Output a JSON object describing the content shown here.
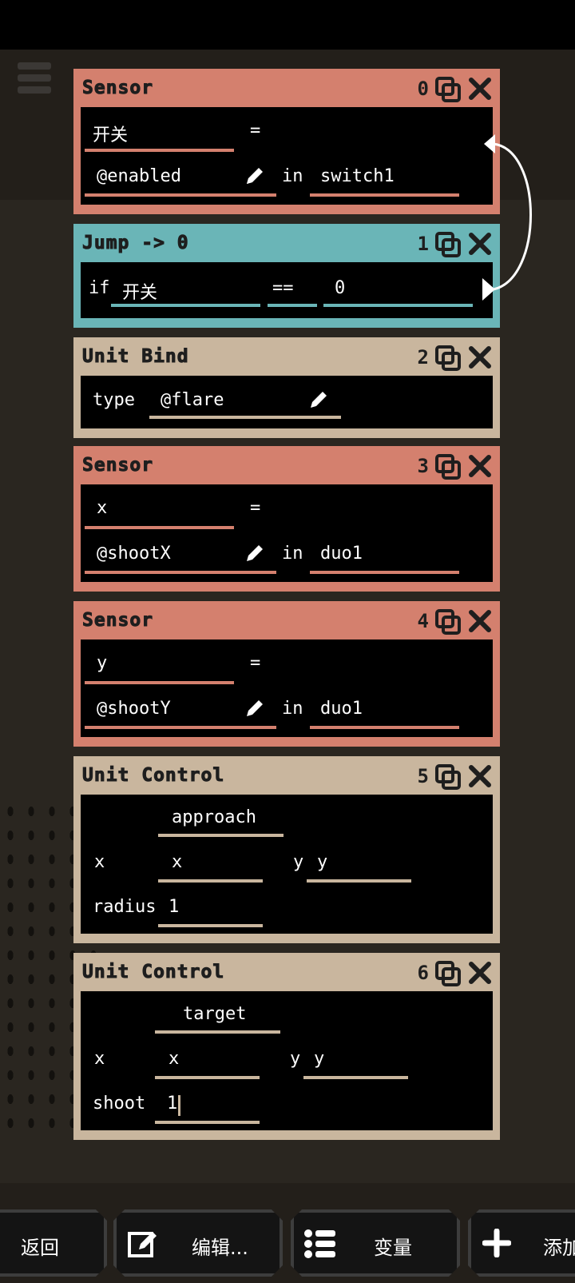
{
  "blocks": [
    {
      "title": "Sensor",
      "index": "0",
      "var": "开关",
      "eq": "=",
      "sensor": "@enabled",
      "in": "in",
      "target": "switch1"
    },
    {
      "title": "Jump -> 0",
      "index": "1",
      "if": "if",
      "a": "开关",
      "op": "==",
      "b": "0"
    },
    {
      "title": "Unit Bind",
      "index": "2",
      "type_label": "type",
      "type_value": "@flare"
    },
    {
      "title": "Sensor",
      "index": "3",
      "var": "x",
      "eq": "=",
      "sensor": "@shootX",
      "in": "in",
      "target": "duo1"
    },
    {
      "title": "Sensor",
      "index": "4",
      "var": "y",
      "eq": "=",
      "sensor": "@shootY",
      "in": "in",
      "target": "duo1"
    },
    {
      "title": "Unit Control",
      "index": "5",
      "mode": "approach",
      "x_label": "x",
      "x_value": "x",
      "y_label": "y",
      "y_value": "y",
      "r_label": "radius",
      "r_value": "1"
    },
    {
      "title": "Unit Control",
      "index": "6",
      "mode": "target",
      "x_label": "x",
      "x_value": "x",
      "y_label": "y",
      "y_value": "y",
      "s_label": "shoot",
      "s_value": "1"
    }
  ],
  "footer": {
    "back": "返回",
    "edit": "编辑...",
    "vars": "变量",
    "add": "添加"
  },
  "colors": {
    "sensor": "#d4806e",
    "jump": "#6ab5b7",
    "unit": "#c9b69e"
  }
}
